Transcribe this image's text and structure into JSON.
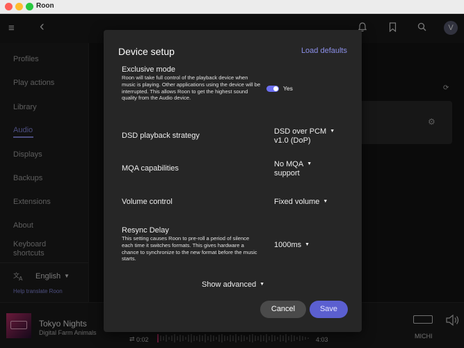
{
  "window": {
    "title": "Roon"
  },
  "topbar": {
    "menu_icon": "≡",
    "back_icon": "‹",
    "bell_icon": "🔔",
    "bookmark_icon": "⚑",
    "search_icon": "⌕",
    "avatar_letter": "V"
  },
  "sidebar": {
    "items": [
      {
        "label": "Profiles"
      },
      {
        "label": "Play actions"
      },
      {
        "label": "Library"
      },
      {
        "label": "Audio",
        "active": true
      },
      {
        "label": "Displays"
      },
      {
        "label": "Backups"
      },
      {
        "label": "Extensions"
      },
      {
        "label": "About"
      },
      {
        "label": "Keyboard shortcuts"
      }
    ],
    "language": "English",
    "help_link": "Help translate Roon"
  },
  "modal": {
    "title": "Device setup",
    "load_defaults": "Load defaults",
    "exclusive_mode": {
      "label": "Exclusive mode",
      "description": "Roon will take full control of the playback device when music is playing. Other applications using the device will be interrupted. This allows Roon to get the highest sound quality from the Audio device.",
      "toggle_label": "Yes",
      "enabled": true
    },
    "dsd": {
      "label": "DSD playback strategy",
      "value_line1": "DSD over PCM",
      "value_line2": "v1.0 (DoP)"
    },
    "mqa": {
      "label": "MQA capabilities",
      "value_line1": "No MQA",
      "value_line2": "support"
    },
    "volume": {
      "label": "Volume control",
      "value": "Fixed volume"
    },
    "resync": {
      "label": "Resync Delay",
      "description": "This setting causes Roon to pre-roll a period of silence each time it switches formats. This gives hardware a chance to synchronize to the new format before the music starts.",
      "value": "1000ms"
    },
    "show_advanced": "Show advanced",
    "cancel": "Cancel",
    "save": "Save"
  },
  "player": {
    "track_title": "Tokyo Nights",
    "artist": "Digital Farm Animals",
    "elapsed": "0:02",
    "total": "4:03",
    "zone": "MICHI"
  },
  "colors": {
    "accent": "#8b8fe8",
    "save_button": "#5b5fd0",
    "toggle": "#6b6ff0"
  }
}
